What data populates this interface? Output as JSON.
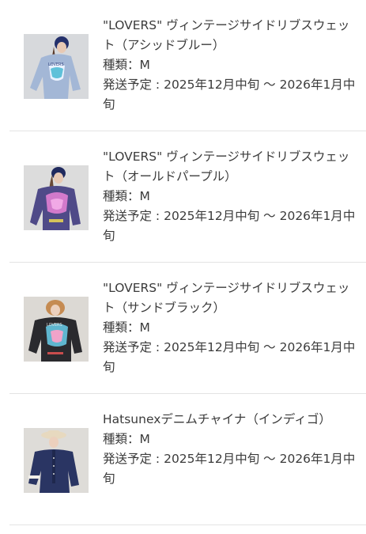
{
  "products": [
    {
      "title": "\"LOVERS\" ヴィンテージサイドリブスウェット（アシッドブルー）",
      "type_label": "種類：",
      "type_value": "M",
      "shipping_label": "発送予定 : ",
      "shipping_value": "2025年12月中旬 〜 2026年1月中旬",
      "thumb_icon": "product-photo-acid-blue-sweatshirt",
      "garment_color": "#9fb4d3",
      "bg_color": "#d8dadc"
    },
    {
      "title": "\"LOVERS\" ヴィンテージサイドリブスウェット（オールドパープル）",
      "type_label": "種類：",
      "type_value": "M",
      "shipping_label": "発送予定 : ",
      "shipping_value": "2025年12月中旬 〜 2026年1月中旬",
      "thumb_icon": "product-photo-old-purple-sweatshirt",
      "garment_color": "#4e4a86",
      "bg_color": "#dcdcdc"
    },
    {
      "title": "\"LOVERS\" ヴィンテージサイドリブスウェット（サンドブラック）",
      "type_label": "種類：",
      "type_value": "M",
      "shipping_label": "発送予定 : ",
      "shipping_value": "2025年12月中旬 〜 2026年1月中旬",
      "thumb_icon": "product-photo-sand-black-sweatshirt",
      "garment_color": "#2b2b2e",
      "bg_color": "#dcdad6"
    },
    {
      "title": "Hatsunexデニムチャイナ（インディゴ）",
      "type_label": "種類：",
      "type_value": "M",
      "shipping_label": "発送予定 : ",
      "shipping_value": "2025年12月中旬 〜 2026年1月中旬",
      "thumb_icon": "product-photo-indigo-denim-china",
      "garment_color": "#283463",
      "bg_color": "#dedcd8"
    }
  ]
}
